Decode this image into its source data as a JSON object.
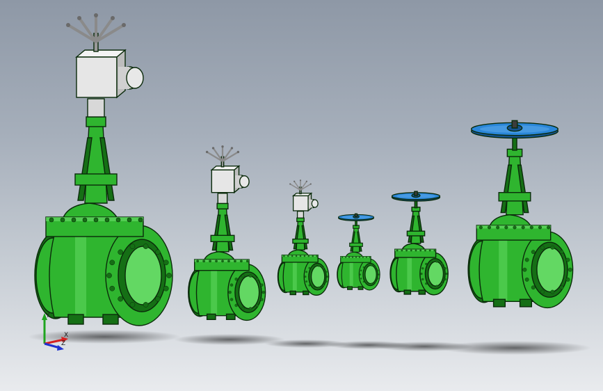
{
  "view": {
    "background_top": "#8e98a6",
    "background_bottom": "#e9ebee"
  },
  "colors": {
    "valve_body": "#2fb52f",
    "valve_dark": "#156f15",
    "valve_light": "#63d863",
    "handwheel": "#2a86d8",
    "handwheel_dark": "#14538f",
    "actuator": "#e6e6e6",
    "outline": "#0a2a0a"
  },
  "triad": {
    "x_label": "X",
    "y_label": "Y",
    "z_label": "Z",
    "x_color": "#d62020",
    "y_color": "#1fa51f",
    "z_color": "#2030d0"
  },
  "valves": [
    {
      "id": "valve-1",
      "operator": "electric-actuator",
      "relative_size": 1.0
    },
    {
      "id": "valve-2",
      "operator": "electric-actuator",
      "relative_size": 0.55
    },
    {
      "id": "valve-3",
      "operator": "electric-actuator",
      "relative_size": 0.36
    },
    {
      "id": "valve-4",
      "operator": "handwheel",
      "relative_size": 0.3
    },
    {
      "id": "valve-5",
      "operator": "handwheel",
      "relative_size": 0.4
    },
    {
      "id": "valve-6",
      "operator": "handwheel",
      "relative_size": 0.7
    }
  ]
}
